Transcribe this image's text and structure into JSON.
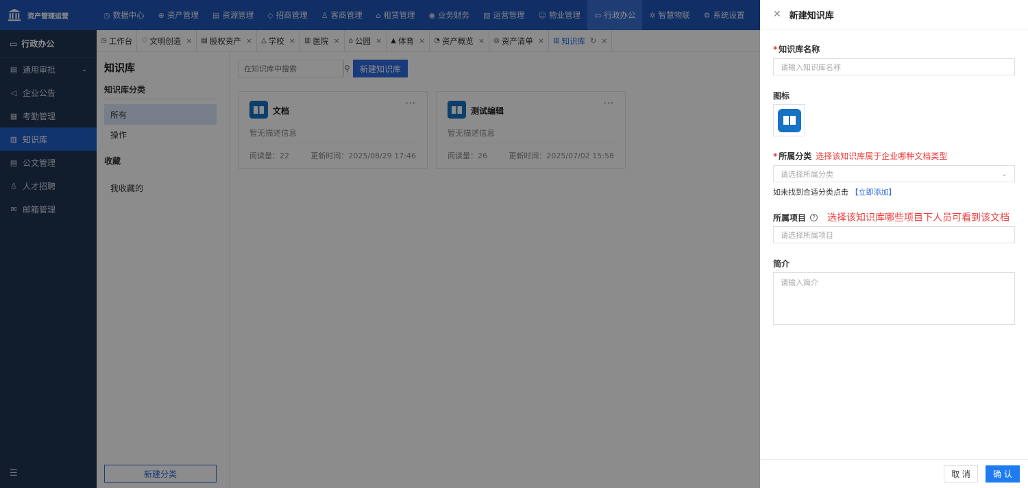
{
  "brand": {
    "name": "资产管理运营"
  },
  "topnav": [
    {
      "icon": "◷",
      "label": "数据中心"
    },
    {
      "icon": "⊕",
      "label": "资产管理"
    },
    {
      "icon": "▤",
      "label": "资源管理"
    },
    {
      "icon": "◇",
      "label": "招商管理"
    },
    {
      "icon": "♙",
      "label": "客商管理"
    },
    {
      "icon": "⌂",
      "label": "租赁管理"
    },
    {
      "icon": "◉",
      "label": "业务财务"
    },
    {
      "icon": "▧",
      "label": "运营管理"
    },
    {
      "icon": "☺",
      "label": "物业管理"
    },
    {
      "icon": "▭",
      "label": "行政办公",
      "active": true
    },
    {
      "icon": "✲",
      "label": "智慧物联"
    },
    {
      "icon": "⚙",
      "label": "系统设置"
    }
  ],
  "sidebar": {
    "section": "行政办公",
    "items": [
      {
        "icon": "▤",
        "label": "通用审批",
        "chevron": "⌄"
      },
      {
        "icon": "◁",
        "label": "企业公告"
      },
      {
        "icon": "▦",
        "label": "考勤管理"
      },
      {
        "icon": "▥",
        "label": "知识库",
        "active": true
      },
      {
        "icon": "▤",
        "label": "公文管理"
      },
      {
        "icon": "♙",
        "label": "人才招聘"
      },
      {
        "icon": "✉",
        "label": "邮箱管理"
      }
    ],
    "collapse_icon": "☰"
  },
  "tabs": [
    {
      "icon": "◷",
      "label": "工作台"
    },
    {
      "icon": "♡",
      "label": "文明创造",
      "close": "×"
    },
    {
      "icon": "▤",
      "label": "股权资产",
      "close": "×"
    },
    {
      "icon": "△",
      "label": "学校",
      "close": "×"
    },
    {
      "icon": "▥",
      "label": "医院",
      "close": "×"
    },
    {
      "icon": "⌂",
      "label": "公园",
      "close": "×"
    },
    {
      "icon": "▲",
      "label": "体育",
      "close": "×"
    },
    {
      "icon": "◔",
      "label": "资产概览",
      "close": "×"
    },
    {
      "icon": "◎",
      "label": "资产清单",
      "close": "×"
    },
    {
      "icon": "▥",
      "label": "知识库",
      "close": "×",
      "refresh": "↻",
      "active": true
    }
  ],
  "kpanel": {
    "title": "知识库",
    "category_label": "知识库分类",
    "categories": [
      "所有",
      "操作"
    ],
    "favorites_label": "收藏",
    "favorites_item": "我收藏的",
    "new_category": "新建分类"
  },
  "main": {
    "search_placeholder": "在知识库中搜索",
    "new_kb": "新建知识库",
    "cards": [
      {
        "title": "文档",
        "desc": "暂无描述信息",
        "reads": "阅读量：22",
        "updated": "更新时间：2025/08/29 17:46",
        "more": "···"
      },
      {
        "title": "测试编辑",
        "desc": "暂无描述信息",
        "reads": "阅读量：26",
        "updated": "更新时间：2025/07/02 15:58",
        "more": "···"
      }
    ]
  },
  "drawer": {
    "title": "新建知识库",
    "close_icon": "✕",
    "name_label": "知识库名称",
    "name_placeholder": "请输入知识库名称",
    "icon_label": "图标",
    "category_label": "所属分类",
    "category_hint": "选择该知识库属于企业哪种文档类型",
    "category_placeholder": "请选择所属分类",
    "category_caret": "⌄",
    "not_found_text": "如未找到合适分类点击",
    "add_now": "【立即添加】",
    "project_label": "所属项目",
    "project_help": "?",
    "project_hint": "选择该知识库哪些项目下人员可看到该文档",
    "project_placeholder": "请选择所属项目",
    "intro_label": "简介",
    "intro_placeholder": "请输入简介",
    "cancel": "取 消",
    "confirm": "确 认",
    "required_mark": "*"
  },
  "colors": {
    "primary": "#1f54b8",
    "sidebar": "#1f3452",
    "accent": "#2f6be0",
    "hint": "#f03c3c"
  }
}
